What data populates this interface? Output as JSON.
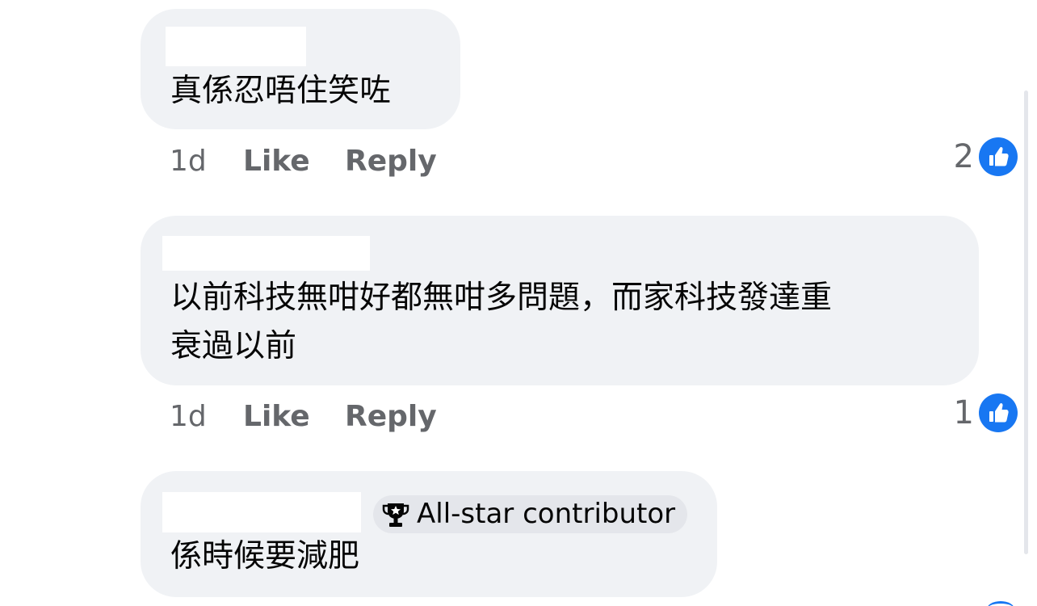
{
  "comments": [
    {
      "text": "真係忍唔住笑咗",
      "time": "1d",
      "like_label": "Like",
      "reply_label": "Reply",
      "reaction_count": "2",
      "reaction_icon": "thumbs-up-icon"
    },
    {
      "text_line1": "以前科技無咁好都無咁多問題，而家科技發達重",
      "text_line2": "衰過以前",
      "time": "1d",
      "like_label": "Like",
      "reply_label": "Reply",
      "reaction_count": "1",
      "reaction_icon": "thumbs-up-icon"
    },
    {
      "badge_icon": "trophy-icon",
      "badge_label": "All-star contributor",
      "text": "係時候要減肥"
    }
  ],
  "colors": {
    "bubble_bg": "#f0f2f5",
    "like_blue": "#1877f2",
    "secondary_text": "#65676b",
    "primary_text": "#050505"
  }
}
